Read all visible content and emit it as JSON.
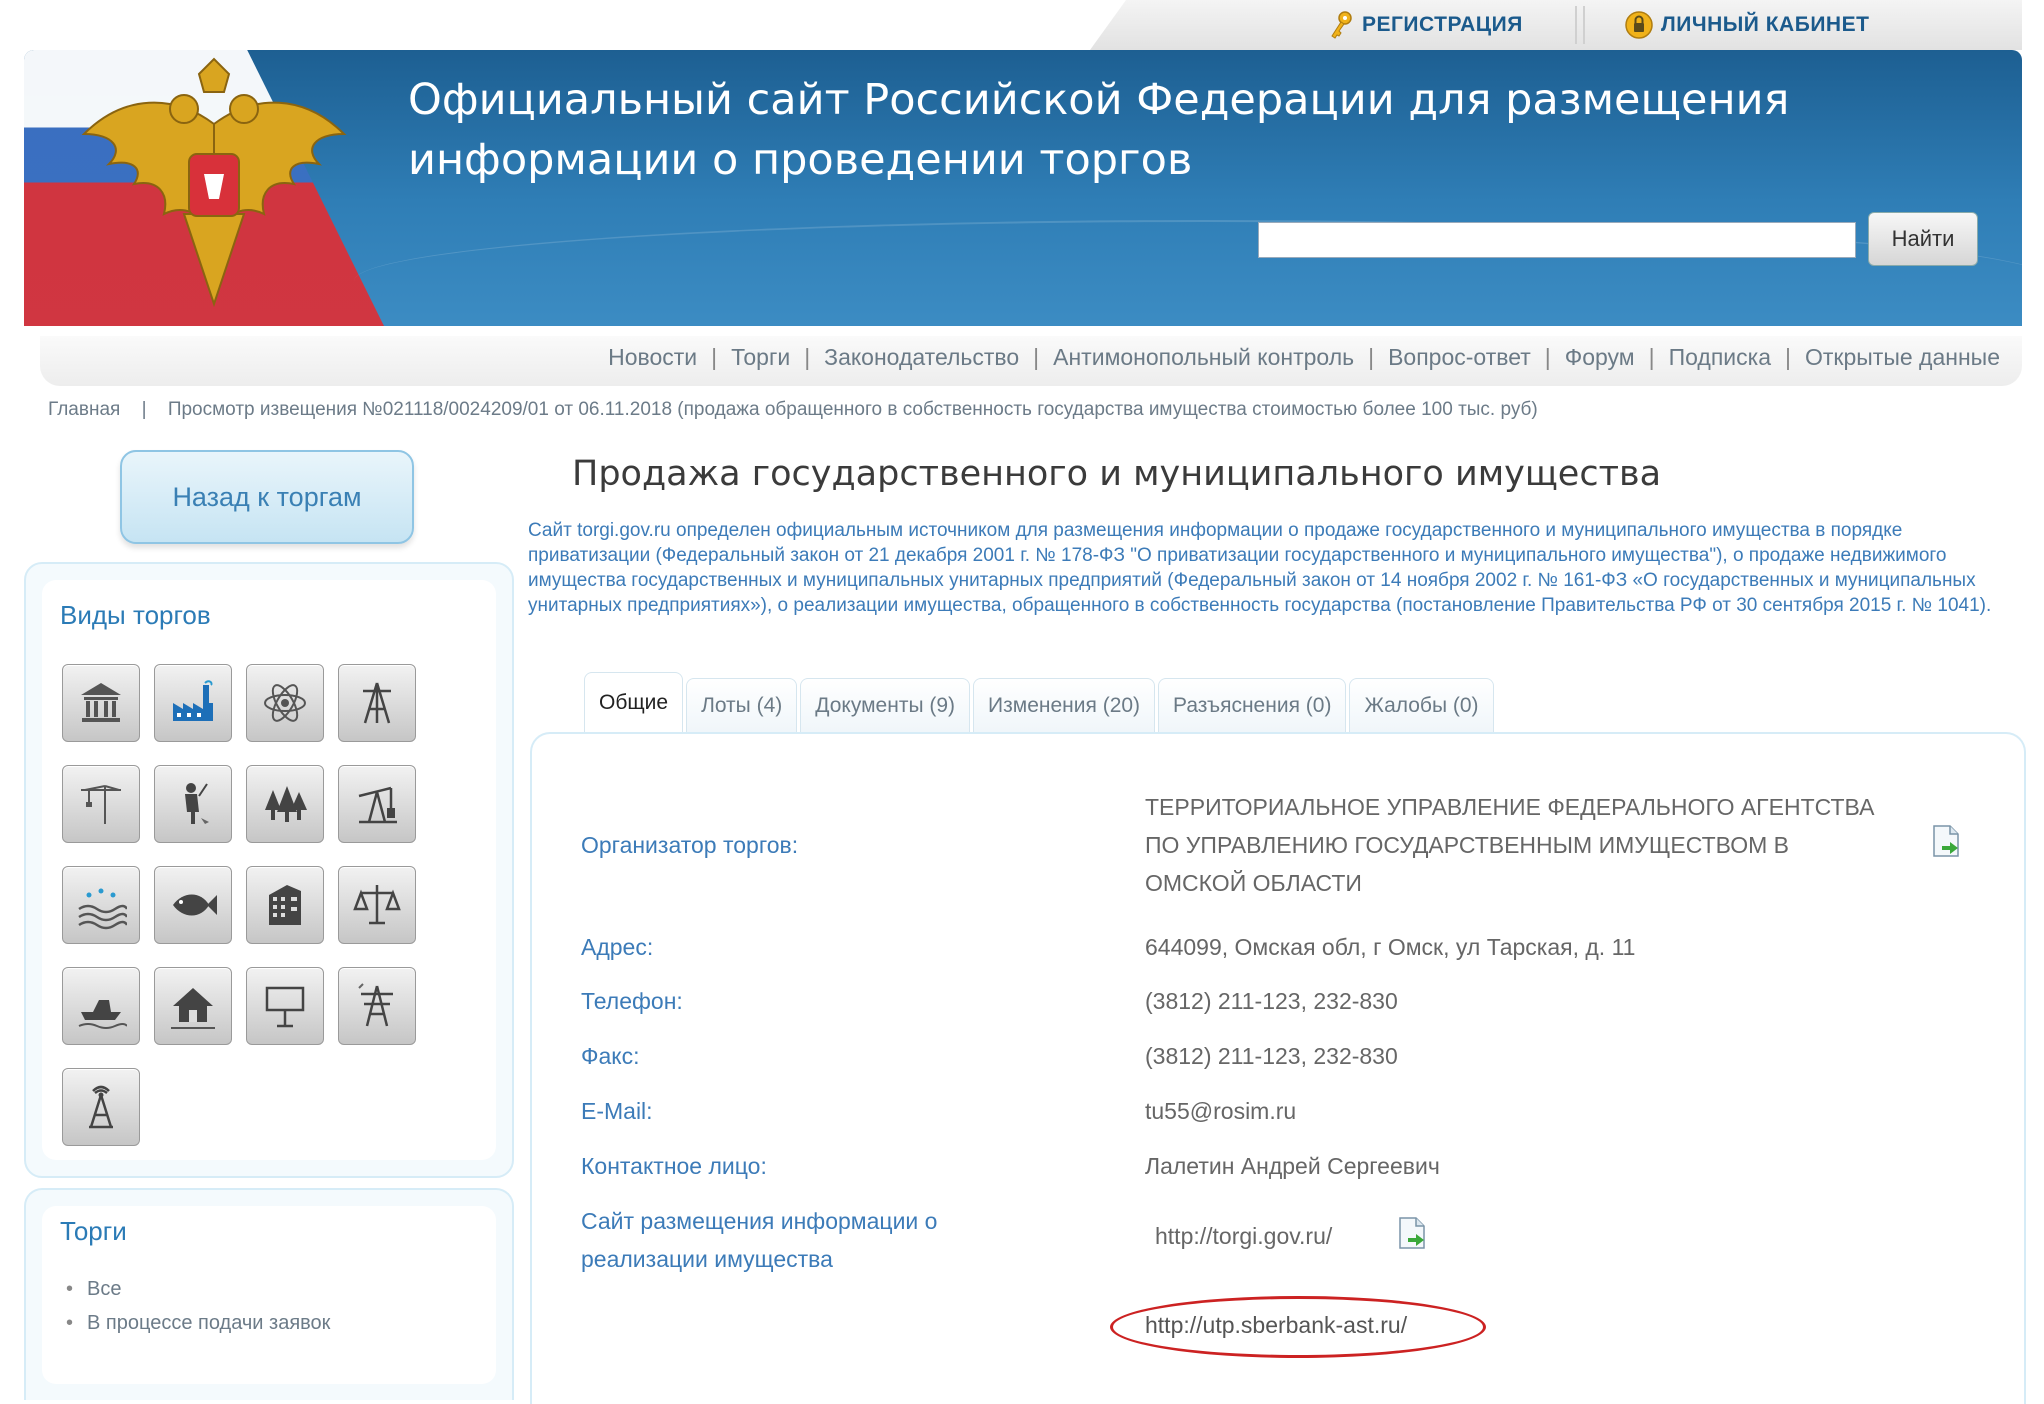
{
  "topbar": {
    "registration": "РЕГИСТРАЦИЯ",
    "cabinet": "ЛИЧНЫЙ КАБИНЕТ",
    "registration_icon": "key-icon",
    "cabinet_icon": "lock-icon"
  },
  "header": {
    "title_line1": "Официальный сайт Российской Федерации для размещения",
    "title_line2": "информации о проведении торгов",
    "search_value": "",
    "search_button": "Найти",
    "brand_color": "#2a6fa6"
  },
  "nav": {
    "items": [
      "Новости",
      "Торги",
      "Законодательство",
      "Антимонопольный контроль",
      "Вопрос-ответ",
      "Форум",
      "Подписка",
      "Открытые данные"
    ],
    "separator": "|"
  },
  "breadcrumb": {
    "home": "Главная",
    "separator": "|",
    "current": "Просмотр извещения №021118/0024209/01 от 06.11.2018 (продажа обращенного в собственность государства имущества стоимостью более 100 тыс. руб)"
  },
  "sidebar": {
    "back_button": "Назад к торгам",
    "types_title": "Виды торгов",
    "type_icons": [
      "government-building-icon",
      "factory-icon",
      "atom-icon",
      "drilling-rig-icon",
      "construction-crane-icon",
      "hunter-icon",
      "forest-icon",
      "oil-pump-icon",
      "water-resources-icon",
      "fish-icon",
      "building-icon",
      "scales-icon",
      "boat-icon",
      "house-icon",
      "billboard-icon",
      "power-line-icon",
      "radio-tower-icon"
    ],
    "torgi_title": "Торги",
    "torgi_items": [
      "Все",
      "В процессе подачи заявок"
    ]
  },
  "main": {
    "title": "Продажа государственного и муниципального имущества",
    "intro": "Сайт torgi.gov.ru определен официальным источником для размещения информации о продаже государственного и муниципального имущества в порядке приватизации (Федеральный закон от 21 декабря 2001 г. № 178-ФЗ \"О приватизации государственного и муниципального имущества\"), о продаже недвижимого имущества государственных и муниципальных унитарных предприятий (Федеральный закон от 14 ноября 2002 г. № 161-ФЗ «О государственных и муниципальных унитарных предприятиях»), о реализации имущества, обращенного в собственность государства (постановление Правительства РФ от 30 сентября 2015 г. № 1041).",
    "tabs": [
      {
        "label": "Общие",
        "active": true
      },
      {
        "label": "Лоты (4)",
        "active": false
      },
      {
        "label": "Документы (9)",
        "active": false
      },
      {
        "label": "Изменения (20)",
        "active": false
      },
      {
        "label": "Разъяснения (0)",
        "active": false
      },
      {
        "label": "Жалобы (0)",
        "active": false
      }
    ],
    "fields": {
      "organizer_label": "Организатор торгов:",
      "organizer_value": "ТЕРРИТОРИАЛЬНОЕ УПРАВЛЕНИЕ ФЕДЕРАЛЬНОГО АГЕНТСТВА ПО УПРАВЛЕНИЮ ГОСУДАРСТВЕННЫМ ИМУЩЕСТВОМ В ОМСКОЙ ОБЛАСТИ",
      "address_label": "Адрес:",
      "address_value": "644099, Омская обл, г Омск, ул Тарская, д. 11",
      "phone_label": "Телефон:",
      "phone_value": "(3812) 211-123, 232-830",
      "fax_label": "Факс:",
      "fax_value": "(3812) 211-123, 232-830",
      "email_label": "E-Mail:",
      "email_value": "tu55@rosim.ru",
      "contact_label": "Контактное лицо:",
      "contact_value": "Лалетин Андрей Сергеевич",
      "site_label": "Сайт размещения информации о реализации имущества",
      "site_value": "http://torgi.gov.ru/",
      "etp_value": "http://utp.sberbank-ast.ru/"
    },
    "highlight_color": "#cc2222"
  }
}
